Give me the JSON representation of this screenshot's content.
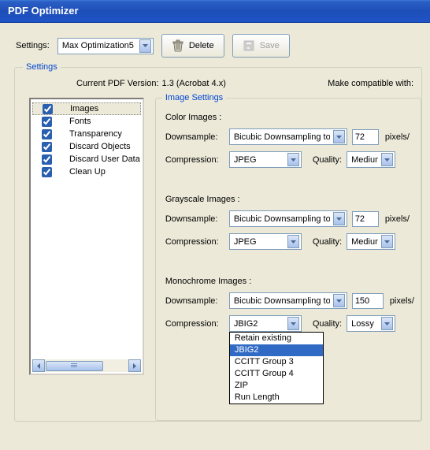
{
  "window_title": "PDF Optimizer",
  "top": {
    "settings_label": "Settings:",
    "preset": "Max Optimization5",
    "delete_label": "Delete",
    "save_label": "Save"
  },
  "settings_group_label": "Settings",
  "version": {
    "current_label": "Current PDF Version:",
    "current_value": "1.3 (Acrobat 4.x)",
    "compat_label": "Make compatible with:"
  },
  "categories": [
    {
      "label": "Images",
      "checked": true,
      "selected": true
    },
    {
      "label": "Fonts",
      "checked": true,
      "selected": false
    },
    {
      "label": "Transparency",
      "checked": true,
      "selected": false
    },
    {
      "label": "Discard Objects",
      "checked": true,
      "selected": false
    },
    {
      "label": "Discard User Data",
      "checked": true,
      "selected": false
    },
    {
      "label": "Clean Up",
      "checked": true,
      "selected": false
    }
  ],
  "imagesettings_label": "Image Settings",
  "labels": {
    "downsample": "Downsample:",
    "compression": "Compression:",
    "quality": "Quality:",
    "pixels": "pixels/"
  },
  "color": {
    "heading": "Color Images :",
    "downsample": "Bicubic Downsampling to",
    "dpi": "72",
    "compression": "JPEG",
    "quality": "Medium"
  },
  "gray": {
    "heading": "Grayscale Images :",
    "downsample": "Bicubic Downsampling to",
    "dpi": "72",
    "compression": "JPEG",
    "quality": "Medium"
  },
  "mono": {
    "heading": "Monochrome Images :",
    "downsample": "Bicubic Downsampling to",
    "dpi": "150",
    "compression": "JBIG2",
    "quality": "Lossy",
    "options": [
      {
        "label": "Retain existing",
        "selected": false
      },
      {
        "label": "JBIG2",
        "selected": true
      },
      {
        "label": "CCITT Group 3",
        "selected": false
      },
      {
        "label": "CCITT Group 4",
        "selected": false
      },
      {
        "label": "ZIP",
        "selected": false
      },
      {
        "label": "Run Length",
        "selected": false
      }
    ]
  }
}
